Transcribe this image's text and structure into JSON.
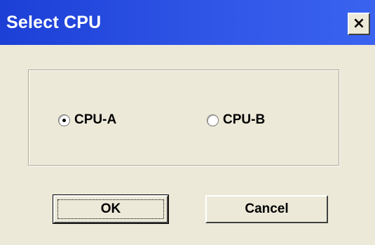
{
  "window": {
    "title": "Select CPU",
    "close_glyph": "×",
    "close_icon": "close-icon"
  },
  "options": {
    "cpu_a": {
      "label": "CPU-A",
      "selected": true
    },
    "cpu_b": {
      "label": "CPU-B",
      "selected": false
    }
  },
  "buttons": {
    "ok_label": "OK",
    "cancel_label": "Cancel"
  },
  "colors": {
    "titlebar_start": "#1c3fd6",
    "titlebar_end": "#3a63f0",
    "dialog_background": "#ece9d8"
  }
}
